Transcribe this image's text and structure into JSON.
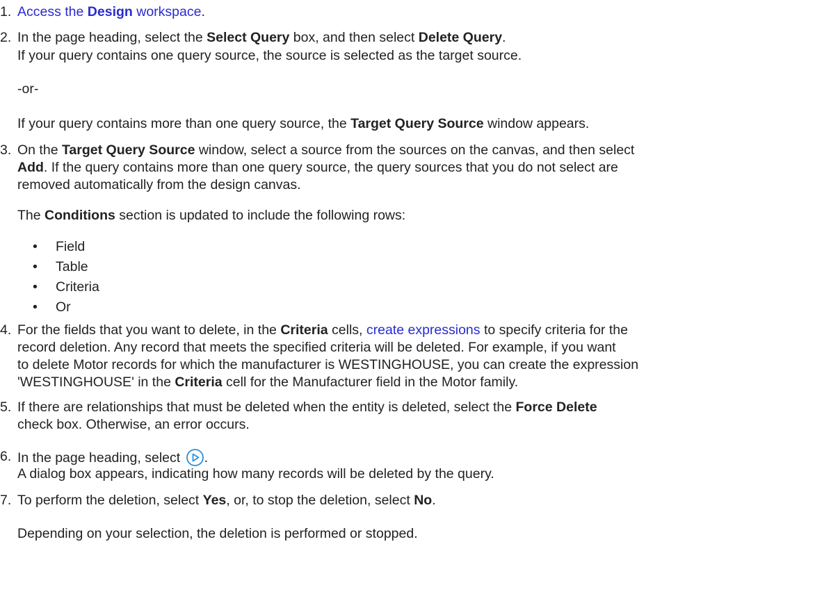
{
  "steps": [
    {
      "num": "1.",
      "pre": "",
      "link": "Access the ",
      "bold": "Design",
      "link2": " workspace",
      "post": "."
    },
    {
      "num": "2.",
      "l1a": "In the page heading, select the ",
      "l1b": "Select Query",
      "l1c": " box, and then select ",
      "l1d": "Delete Query",
      "l1e": ".",
      "l2": "If your query contains one query source, the source is selected as the target source.",
      "or": "-or-",
      "l3a": "If your query contains more than one query source, the ",
      "l3b": "Target Query Source",
      "l3c": " window appears."
    },
    {
      "num": "3.",
      "l1a": "On the ",
      "l1b": "Target Query Source",
      "l1c": " window, select a source from the sources on the canvas, and then select",
      "l2a": "Add",
      "l2b": ". If the query contains more than one query source, the query sources that you do not select are",
      "l3": "removed automatically from the design canvas.",
      "p2a": "The ",
      "p2b": "Conditions",
      "p2c": " section is updated to include the following rows:",
      "bullets": [
        "Field",
        "Table",
        "Criteria",
        "Or"
      ]
    },
    {
      "num": "4.",
      "l1a": "For the fields that you want to delete, in the ",
      "l1b": "Criteria",
      "l1c": " cells, ",
      "l1link": "create expressions",
      "l1d": " to specify criteria for the",
      "l2": "record deletion. Any record that meets the specified criteria will be deleted. For example, if you want",
      "l3": "to delete Motor records for which the manufacturer is WESTINGHOUSE, you can create the expression",
      "l4a": "'WESTINGHOUSE' in the ",
      "l4b": "Criteria",
      "l4c": " cell for the Manufacturer field in the Motor family."
    },
    {
      "num": "5.",
      "l1a": "If there are relationships that must be deleted when the entity is deleted, select the ",
      "l1b": "Force Delete",
      "l2": "check box. Otherwise, an error occurs."
    },
    {
      "num": "6.",
      "l1a": "In the page heading, select ",
      "l1b": ".",
      "l2": "A dialog box appears, indicating how many records will be deleted by the query."
    },
    {
      "num": "7.",
      "l1a": "To perform the deletion, select ",
      "l1b": "Yes",
      "l1c": ", or, to stop the deletion, select ",
      "l1d": "No",
      "l1e": ".",
      "p2": "Depending on your selection, the deletion is performed or stopped."
    }
  ],
  "icons": {
    "run": "run-play-icon",
    "run_color": "#2a8fd8"
  }
}
